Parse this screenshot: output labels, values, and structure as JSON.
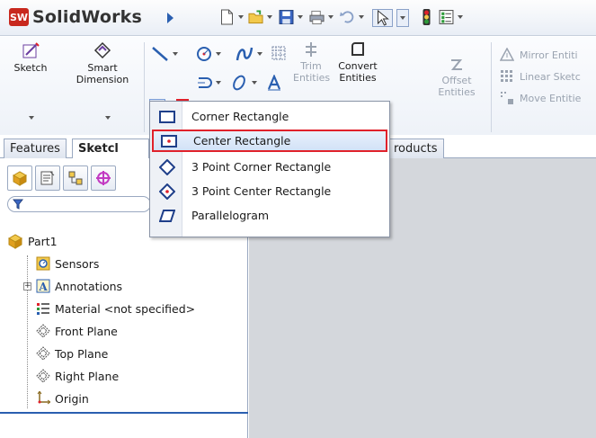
{
  "app": {
    "title": "SolidWorks",
    "logo_mark": "SW"
  },
  "colors": {
    "accent_red": "#e0212b",
    "brand_blue": "#2a5fb0",
    "graphics_bg": "#d4d7dc"
  },
  "quick_access": {
    "icons": [
      "new-document-icon",
      "open-folder-icon",
      "save-icon",
      "print-icon",
      "undo-icon",
      "select-icon",
      "rebuild-icon",
      "options-icon"
    ]
  },
  "ribbon": {
    "sketch_label": "Sketch",
    "smart_dimension_label": "Smart Dimension",
    "trim_label": "Trim Entities",
    "convert_label": "Convert Entities",
    "offset_label": "Offset Entities",
    "mirror_label": "Mirror Entiti",
    "linear_label": "Linear Sketc",
    "move_label": "Move Entitie"
  },
  "tabs": {
    "features": "Features",
    "sketch": "Sketcl",
    "products": "roducts"
  },
  "feature_tree": {
    "root": "Part1",
    "items": [
      "Sensors",
      "Annotations",
      "Material <not specified>",
      "Front Plane",
      "Top Plane",
      "Right Plane",
      "Origin"
    ]
  },
  "rectangle_menu": {
    "items": [
      {
        "label": "Corner Rectangle",
        "icon": "corner-rectangle-icon"
      },
      {
        "label": "Center Rectangle",
        "icon": "center-rectangle-icon"
      },
      {
        "label": "3 Point Corner Rectangle",
        "icon": "3-point-corner-rectangle-icon"
      },
      {
        "label": "3 Point Center Rectangle",
        "icon": "3-point-center-rectangle-icon"
      },
      {
        "label": "Parallelogram",
        "icon": "parallelogram-icon"
      }
    ],
    "highlighted": "Center Rectangle"
  }
}
